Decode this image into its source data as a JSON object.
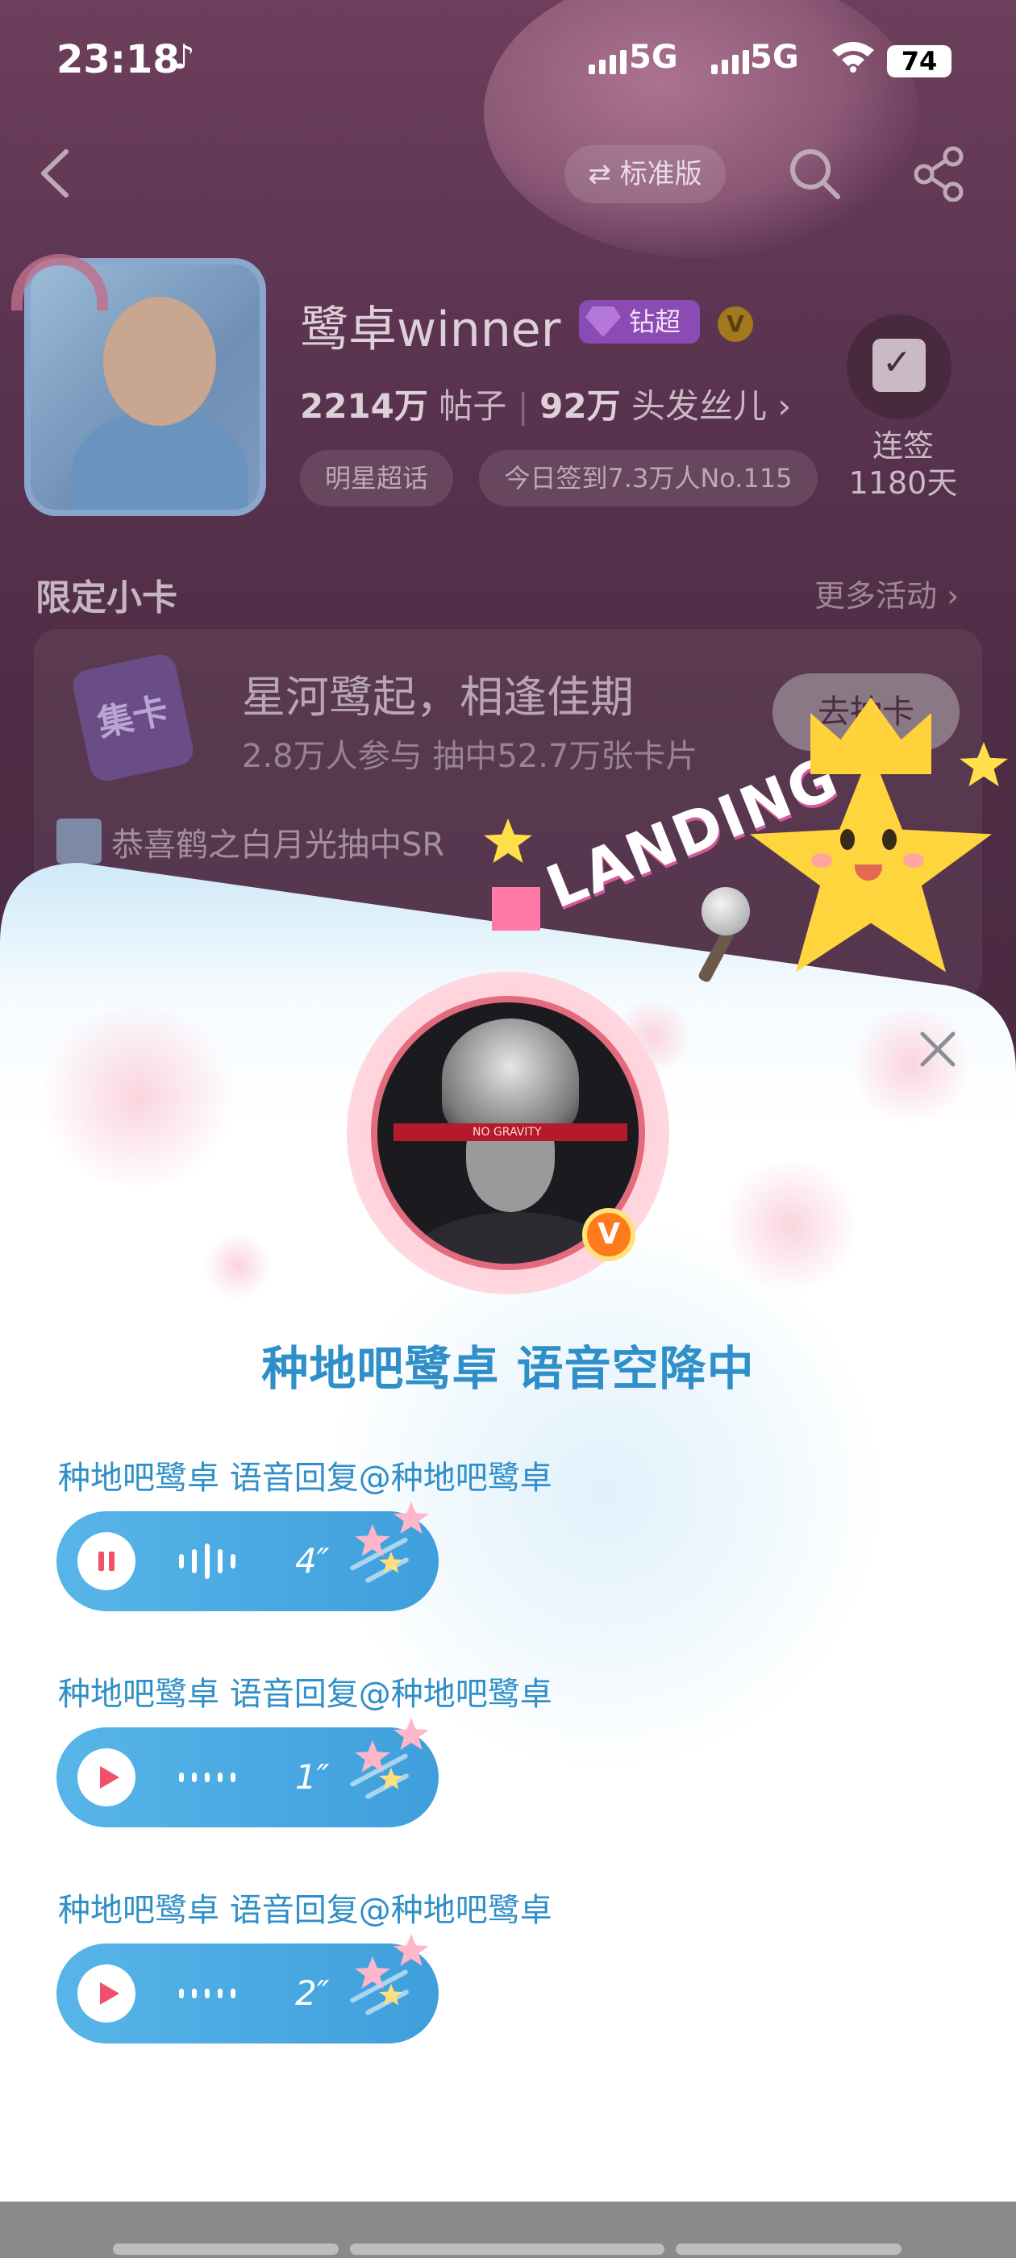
{
  "status_bar": {
    "time": "23:18",
    "app_icon": "tiktok-icon",
    "network_1": "5G",
    "network_2": "5G",
    "battery": "74"
  },
  "header": {
    "back_icon": "back-arrow-icon",
    "version_toggle": "⇄ 标准版",
    "search_icon": "search-icon",
    "share_icon": "share-icon"
  },
  "forum": {
    "name": "鹭卓winner",
    "level_badge": "钻超",
    "verified": "V",
    "posts_count": "2214万",
    "posts_label": "帖子",
    "fans_count": "92万",
    "fans_label": "头发丝儿 ›",
    "tags": [
      "明星超话",
      "今日签到7.3万人No.115"
    ],
    "checkin_label": "连签",
    "checkin_days": "1180天"
  },
  "limited_cards": {
    "section_title": "限定小卡",
    "more_link": "更多活动 ›",
    "card_icon_text": "集卡",
    "card_title": "星河鹭起，相逢佳期",
    "card_subtitle": "2.8万人参与 抽中52.7万张卡片",
    "card_button": "去抽卡",
    "ticker": "恭喜鹤之白月光抽中SR"
  },
  "landing_banner": {
    "text": "LANDING"
  },
  "popup": {
    "close_icon": "close-icon",
    "avatar_caption": "NO GRAVITY",
    "avatar_badge": "V",
    "title": "种地吧鹭卓 语音空降中",
    "voice_replies": [
      {
        "label": "种地吧鹭卓 语音回复@种地吧鹭卓",
        "duration": "4″",
        "state": "pause"
      },
      {
        "label": "种地吧鹭卓 语音回复@种地吧鹭卓",
        "duration": "1″",
        "state": "play"
      },
      {
        "label": "种地吧鹭卓 语音回复@种地吧鹭卓",
        "duration": "2″",
        "state": "play"
      }
    ]
  },
  "colors": {
    "accent_blue": "#2f8fc8",
    "pill_blue": "#4aa9e2",
    "play_red": "#f0506a",
    "star_yellow": "#ffd53d"
  }
}
